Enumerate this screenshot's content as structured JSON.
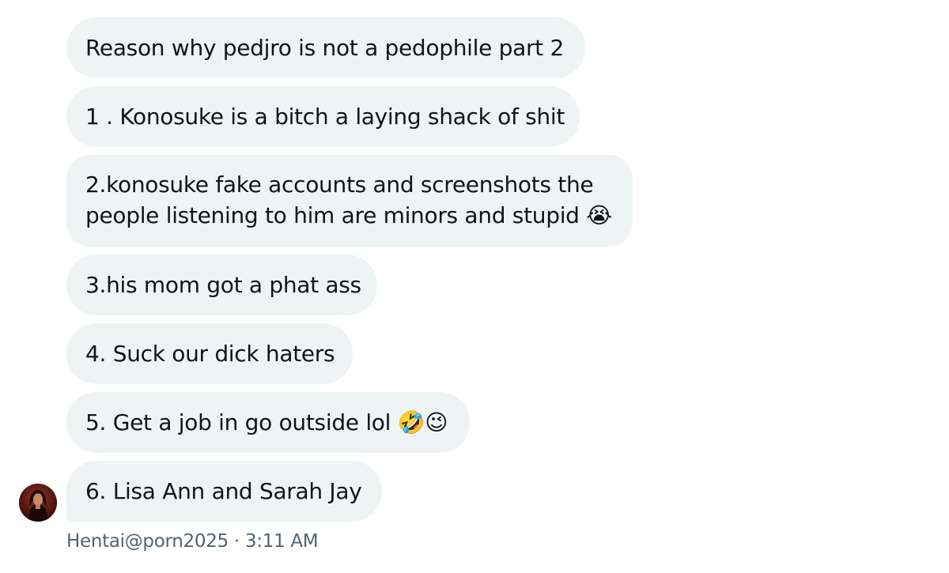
{
  "messages": [
    {
      "text": "Reason why pedjro is not a pedophile part 2"
    },
    {
      "text": "1 . Konosuke is a bitch a laying shack of shit"
    },
    {
      "lines": [
        "2.konosuke fake accounts and screenshots the",
        "people listening to him are minors and stupid 😭"
      ]
    },
    {
      "text": "3.his mom got a phat ass"
    },
    {
      "text": "4. Suck our dick haters"
    },
    {
      "text": "5. Get a job in go outside lol 🤣😉"
    },
    {
      "text": "6. Lisa Ann and Sarah Jay"
    }
  ],
  "sender": {
    "handle": "Hentai@porn2025",
    "separator": " · ",
    "time": "3:11 AM",
    "avatar_icon": "user-avatar-photo"
  },
  "colors": {
    "bubble_bg": "#eff3f4",
    "text": "#0f1419",
    "meta": "#536471"
  }
}
